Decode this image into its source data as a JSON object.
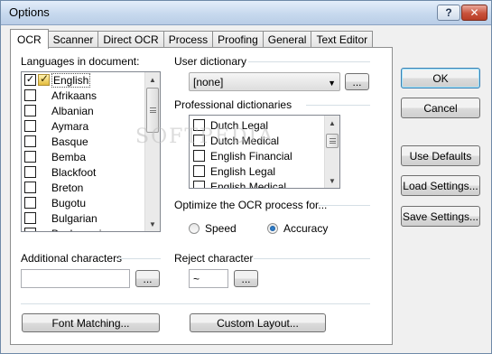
{
  "window": {
    "title": "Options"
  },
  "titlebar": {
    "help_label": "?",
    "close_label": "✕"
  },
  "tabs": [
    {
      "label": "OCR",
      "active": true
    },
    {
      "label": "Scanner"
    },
    {
      "label": "Direct OCR"
    },
    {
      "label": "Process"
    },
    {
      "label": "Proofing"
    },
    {
      "label": "General"
    },
    {
      "label": "Text Editor"
    }
  ],
  "languages": {
    "label": "Languages in document:",
    "items": [
      {
        "name": "English",
        "checked": true,
        "selected": true
      },
      {
        "name": "Afrikaans",
        "checked": false
      },
      {
        "name": "Albanian",
        "checked": false
      },
      {
        "name": "Aymara",
        "checked": false
      },
      {
        "name": "Basque",
        "checked": false
      },
      {
        "name": "Bemba",
        "checked": false
      },
      {
        "name": "Blackfoot",
        "checked": false
      },
      {
        "name": "Breton",
        "checked": false
      },
      {
        "name": "Bugotu",
        "checked": false
      },
      {
        "name": "Bulgarian",
        "checked": false
      },
      {
        "name": "Byelorussian",
        "checked": false
      }
    ]
  },
  "user_dictionary": {
    "label": "User dictionary",
    "value": "[none]",
    "browse_label": "..."
  },
  "professional_dictionaries": {
    "label": "Professional dictionaries",
    "items": [
      {
        "name": "Dutch Legal",
        "checked": false
      },
      {
        "name": "Dutch Medical",
        "checked": false
      },
      {
        "name": "English Financial",
        "checked": false
      },
      {
        "name": "English Legal",
        "checked": false
      },
      {
        "name": "English Medical",
        "checked": false
      }
    ]
  },
  "optimize": {
    "label": "Optimize the OCR process for...",
    "speed_label": "Speed",
    "accuracy_label": "Accuracy",
    "selected": "Accuracy"
  },
  "additional_characters": {
    "label": "Additional characters",
    "value": "",
    "browse_label": "..."
  },
  "reject_character": {
    "label": "Reject character",
    "value": "~",
    "browse_label": "..."
  },
  "buttons": {
    "font_matching": "Font Matching...",
    "custom_layout": "Custom Layout...",
    "ok": "OK",
    "cancel": "Cancel",
    "use_defaults": "Use Defaults",
    "load_settings": "Load Settings...",
    "save_settings": "Save Settings..."
  },
  "watermark": "SOFTPEDIA"
}
